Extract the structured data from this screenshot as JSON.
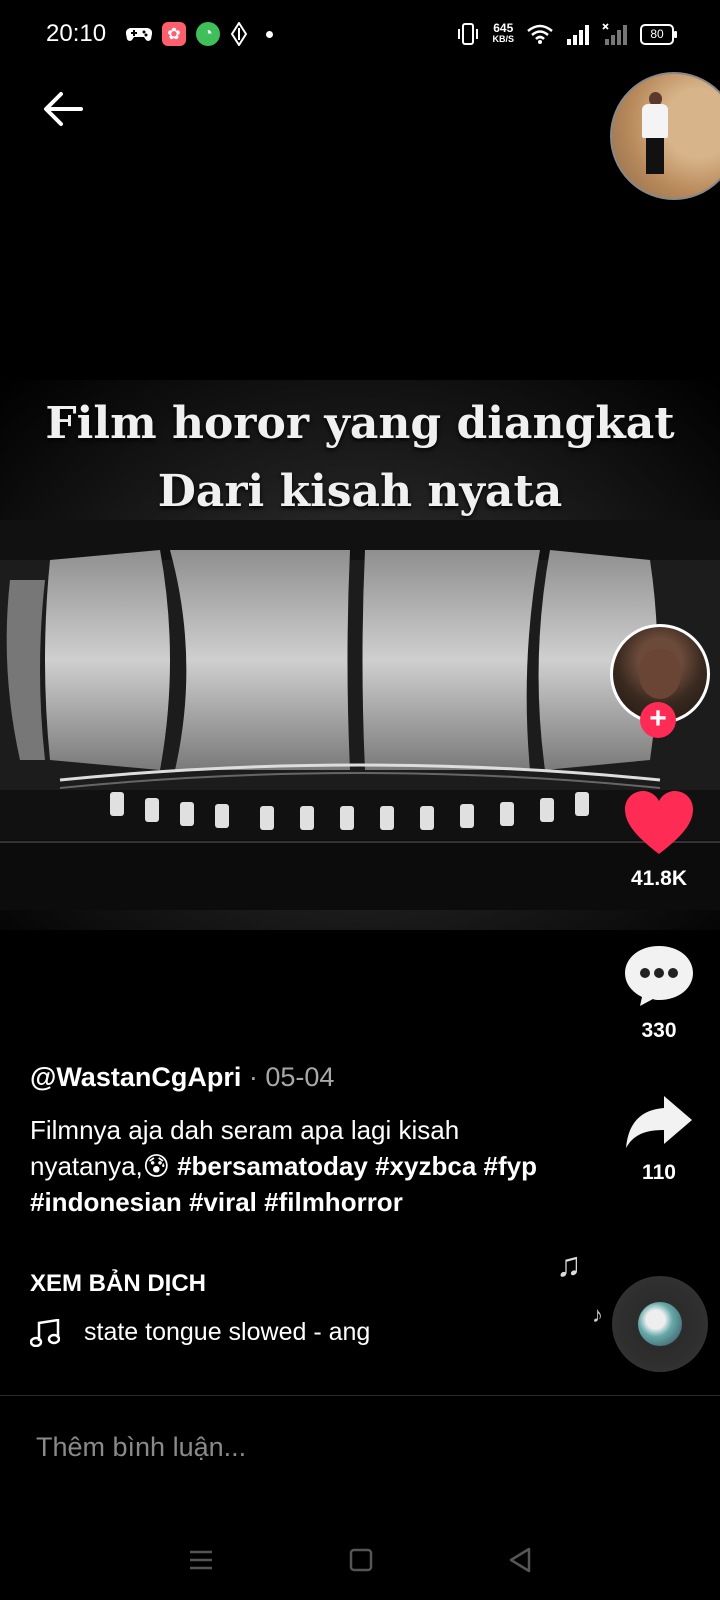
{
  "status": {
    "time": "20:10",
    "net_speed_value": "645",
    "net_speed_unit": "KB/S",
    "battery": "80",
    "icons": [
      "game-controller-icon",
      "app-icon",
      "app-icon",
      "diamond-icon",
      "dot-icon",
      "vibrate-icon",
      "wifi-icon",
      "signal-icon",
      "signal-x-icon",
      "battery-icon"
    ]
  },
  "video": {
    "title_line1": "Film horor yang diangkat",
    "title_line2": "Dari kisah nyata"
  },
  "actions": {
    "likes": "41.8K",
    "comments": "330",
    "shares": "110",
    "like_color": "#fe2c55"
  },
  "post": {
    "username": "@WastanCgApri",
    "date": " · 05-04",
    "caption_text": "Filmnya aja dah seram apa lagi kisah nyatanya,",
    "emoji": "😰",
    "hashtags": [
      "#bersamatoday",
      "#xyzbca",
      "#fyp",
      "#indonesian",
      "#viral",
      "#filmhorror"
    ],
    "translate_label": "XEM BẢN DỊCH",
    "music": "state tongue slowed - ang"
  },
  "comment": {
    "placeholder": "Thêm bình luận..."
  },
  "colors": {
    "background": "#000000",
    "accent": "#fe2c55"
  }
}
